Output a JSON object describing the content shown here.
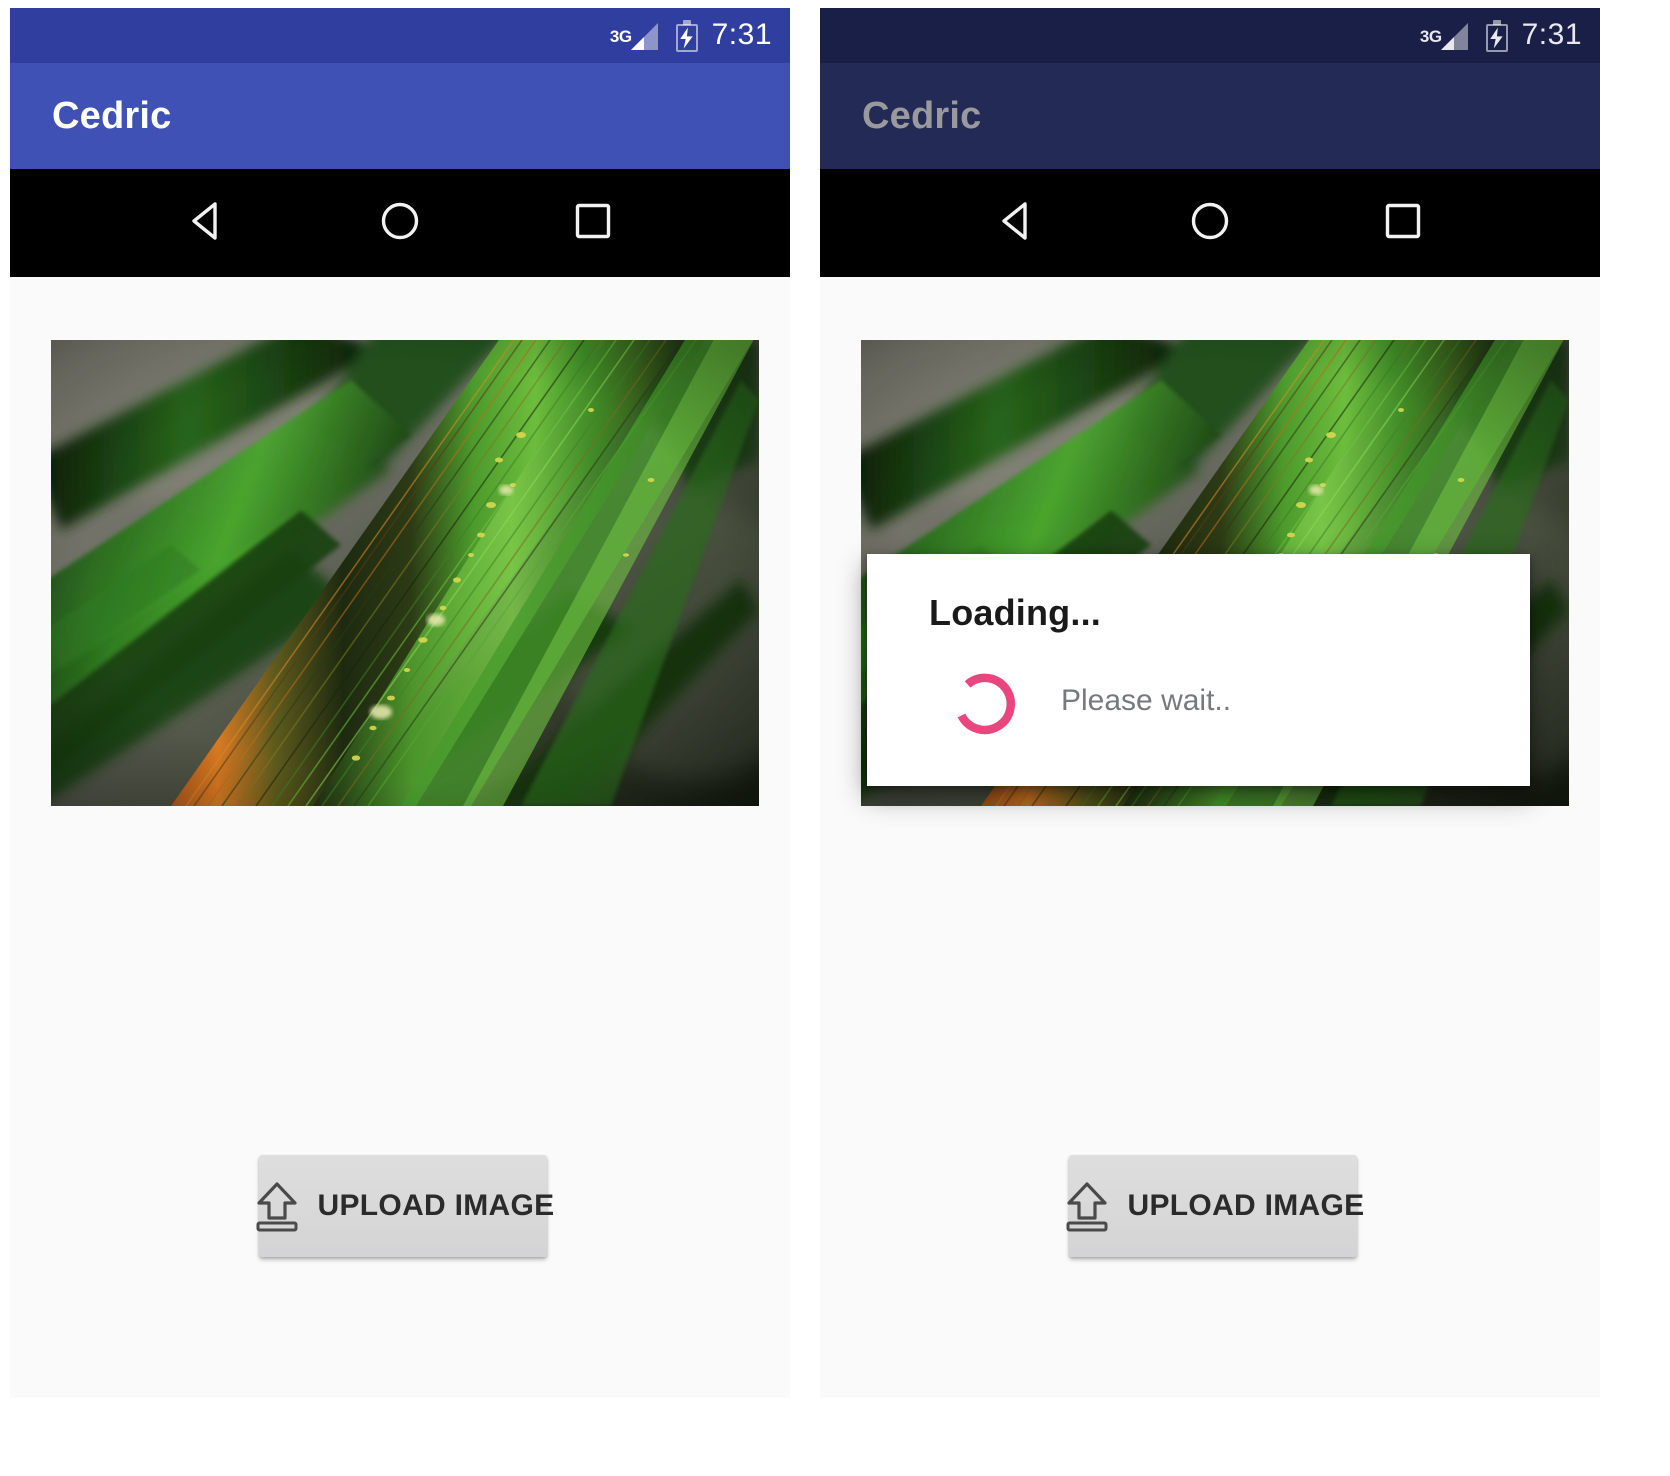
{
  "screens": [
    {
      "id": "screen-idle",
      "statusbar": {
        "network_label": "3G",
        "time": "7:31",
        "signal_icon": "signal-cellular-3g-icon",
        "battery_icon": "battery-charging-icon"
      },
      "appbar": {
        "title": "Cedric"
      },
      "photo": {
        "alt": "close-up macro photograph of green grass blades with an orange-brown rust-streaked stem running diagonally"
      },
      "upload_button": {
        "label": "UPLOAD IMAGE",
        "icon": "upload-arrow-icon"
      },
      "navbar": {
        "back": "back-triangle-icon",
        "home": "home-circle-icon",
        "recents": "recents-square-icon"
      }
    },
    {
      "id": "screen-loading",
      "statusbar": {
        "network_label": "3G",
        "time": "7:31",
        "signal_icon": "signal-cellular-3g-icon",
        "battery_icon": "battery-charging-icon"
      },
      "appbar": {
        "title": "Cedric"
      },
      "photo": {
        "alt": "close-up macro photograph of green grass blades with an orange-brown rust-streaked stem running diagonally"
      },
      "upload_button": {
        "label": "UPLOAD IMAGE",
        "icon": "upload-arrow-icon"
      },
      "dialog": {
        "title": "Loading...",
        "message": "Please wait..",
        "spinner_icon": "circular-progress-spinner-icon"
      },
      "navbar": {
        "back": "back-triangle-icon",
        "home": "home-circle-icon",
        "recents": "recents-square-icon"
      }
    }
  ],
  "colors": {
    "appbar_primary": "#3f51b5",
    "statusbar_primary_dark": "#303f9f",
    "appbar_dimmed": "#232a55",
    "statusbar_dimmed": "#1a1f47",
    "spinner_accent": "#e8467c",
    "dialog_background": "#ffffff",
    "button_face": "#d8d8d9",
    "navbar_background": "#000000",
    "scrim": "rgba(0,0,0,0.45)"
  }
}
